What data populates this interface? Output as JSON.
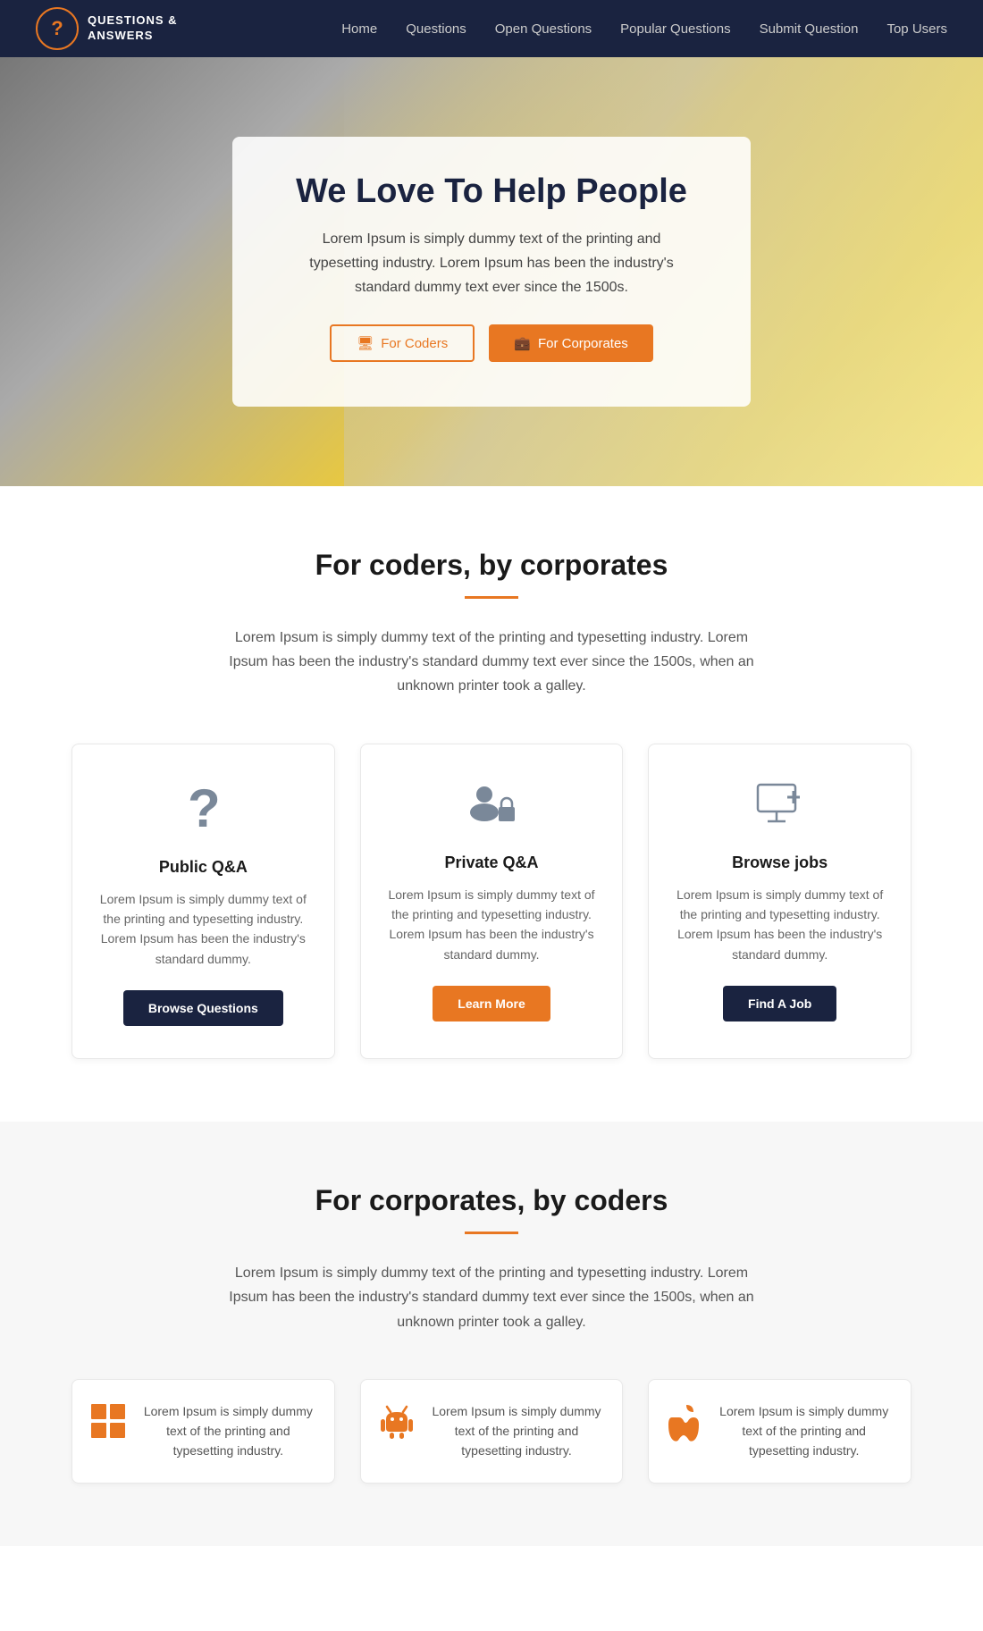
{
  "nav": {
    "logo_line1": "QUESTIONS &",
    "logo_line2": "ANSWERS",
    "links": [
      "Home",
      "Questions",
      "Open Questions",
      "Popular Questions",
      "Submit Question",
      "Top Users"
    ]
  },
  "hero": {
    "title": "We Love To Help People",
    "description": "Lorem Ipsum is simply dummy text of the printing and typesetting industry. Lorem Ipsum has been the industry's standard dummy text ever since the 1500s.",
    "btn_coders": "For Coders",
    "btn_corporates": "For Corporates"
  },
  "section1": {
    "title": "For coders, by corporates",
    "description": "Lorem Ipsum is simply dummy text of the printing and typesetting industry. Lorem Ipsum has been the industry's standard dummy text ever since the 1500s, when an unknown printer took a galley.",
    "cards": [
      {
        "title": "Public Q&A",
        "desc": "Lorem Ipsum is simply dummy text of the printing and typesetting industry. Lorem Ipsum has been the industry's standard dummy.",
        "btn": "Browse Questions",
        "icon": "question-mark"
      },
      {
        "title": "Private Q&A",
        "desc": "Lorem Ipsum is simply dummy text of the printing and typesetting industry. Lorem Ipsum has been the industry's standard dummy.",
        "btn": "Learn More",
        "icon": "users-lock"
      },
      {
        "title": "Browse jobs",
        "desc": "Lorem Ipsum is simply dummy text of the printing and typesetting industry. Lorem Ipsum has been the industry's standard dummy.",
        "btn": "Find A Job",
        "icon": "monitor-plus"
      }
    ]
  },
  "section2": {
    "title": "For corporates, by coders",
    "description": "Lorem Ipsum is simply dummy text of the printing and typesetting industry. Lorem Ipsum has been the industry's standard dummy text ever since the 1500s, when an unknown printer took a galley.",
    "features": [
      {
        "icon": "windows",
        "desc": "Lorem Ipsum is simply dummy text of the printing and typesetting industry."
      },
      {
        "icon": "android",
        "desc": "Lorem Ipsum is simply dummy text of the printing and typesetting industry."
      },
      {
        "icon": "apple",
        "desc": "Lorem Ipsum is simply dummy text of the printing and typesetting industry."
      }
    ]
  }
}
